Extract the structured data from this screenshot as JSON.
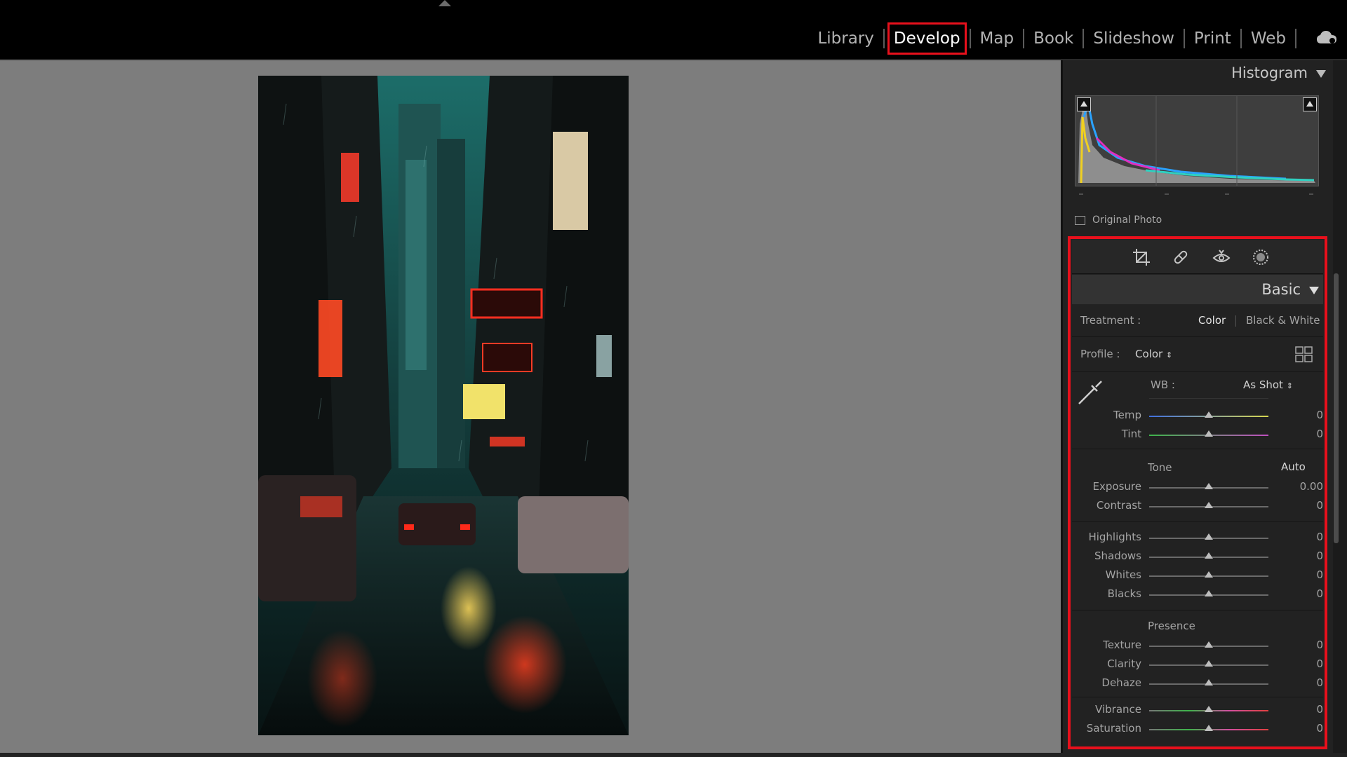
{
  "modules": [
    "Library",
    "Develop",
    "Map",
    "Book",
    "Slideshow",
    "Print",
    "Web"
  ],
  "active_module": "Develop",
  "panel": {
    "histogram_title": "Histogram",
    "original_photo_label": "Original Photo",
    "section_title": "Basic",
    "treatment": {
      "label": "Treatment :",
      "options": [
        "Color",
        "Black & White"
      ],
      "selected": "Color"
    },
    "profile": {
      "label": "Profile :",
      "value": "Color"
    },
    "wb": {
      "label": "WB :",
      "value": "As Shot"
    },
    "tone_label": "Tone",
    "auto_label": "Auto",
    "presence_label": "Presence",
    "sliders": {
      "temp": {
        "label": "Temp",
        "value": "0",
        "position": 0.5
      },
      "tint": {
        "label": "Tint",
        "value": "0",
        "position": 0.5
      },
      "exposure": {
        "label": "Exposure",
        "value": "0.00",
        "position": 0.5
      },
      "contrast": {
        "label": "Contrast",
        "value": "0",
        "position": 0.5
      },
      "highlights": {
        "label": "Highlights",
        "value": "0",
        "position": 0.5
      },
      "shadows": {
        "label": "Shadows",
        "value": "0",
        "position": 0.5
      },
      "whites": {
        "label": "Whites",
        "value": "0",
        "position": 0.5
      },
      "blacks": {
        "label": "Blacks",
        "value": "0",
        "position": 0.5
      },
      "texture": {
        "label": "Texture",
        "value": "0",
        "position": 0.5
      },
      "clarity": {
        "label": "Clarity",
        "value": "0",
        "position": 0.5
      },
      "dehaze": {
        "label": "Dehaze",
        "value": "0",
        "position": 0.5
      },
      "vibrance": {
        "label": "Vibrance",
        "value": "0",
        "position": 0.5
      },
      "saturation": {
        "label": "Saturation",
        "value": "0",
        "position": 0.5
      }
    }
  },
  "icons": [
    "crop-icon",
    "healing-brush-icon",
    "red-eye-icon",
    "masking-icon",
    "eyedropper-icon",
    "cloud-sync-icon",
    "profile-browser-icon"
  ],
  "colors": {
    "highlight": "#e8101c",
    "active_module": "#ffffff",
    "canvas_bg": "#7d7d7d",
    "panel_bg": "#222222"
  }
}
